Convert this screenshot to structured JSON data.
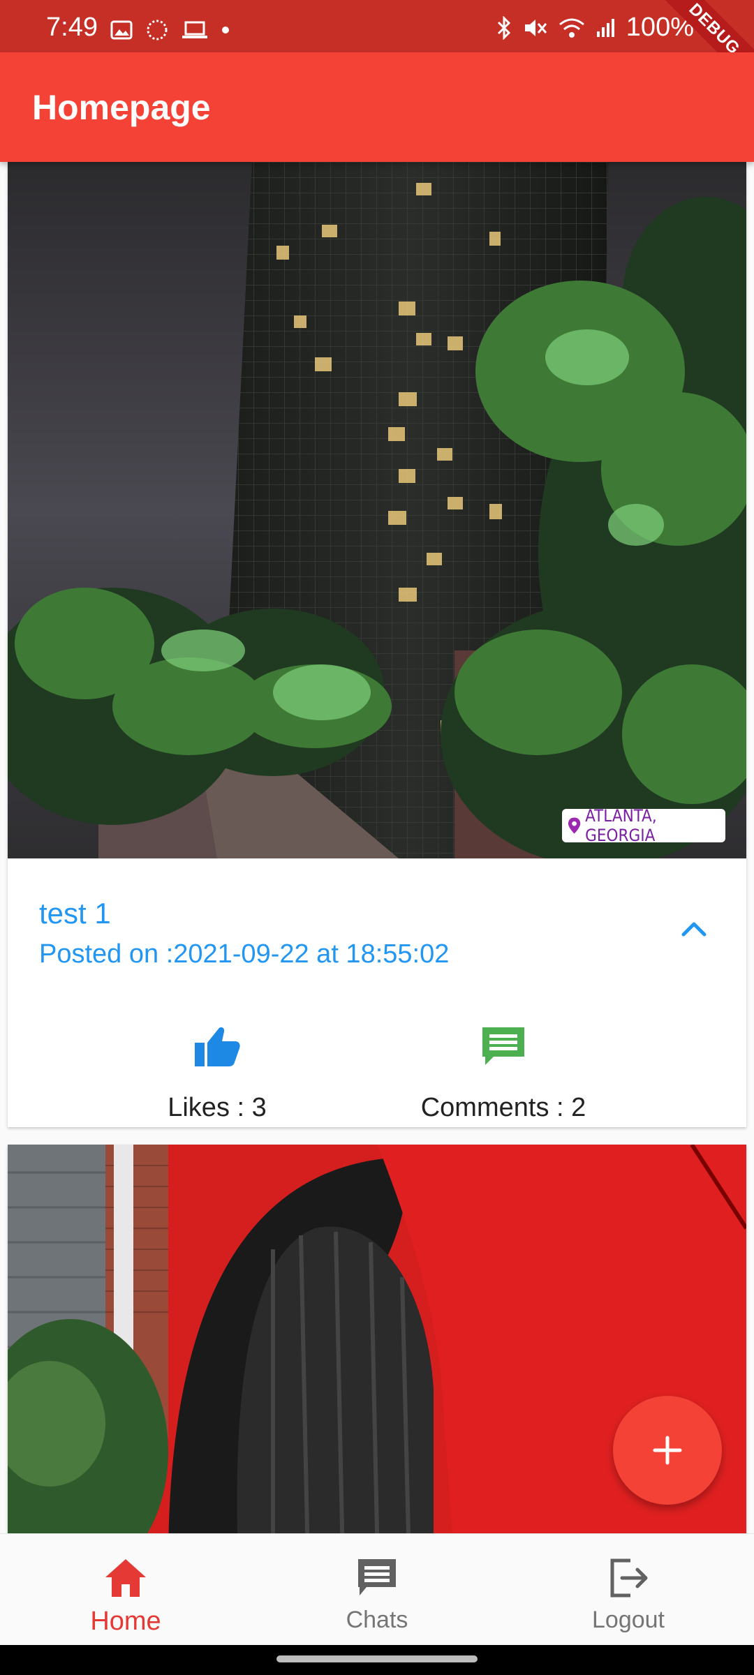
{
  "status_bar": {
    "time": "7:49",
    "battery": "100%",
    "debug_banner": "DEBUG"
  },
  "app_bar": {
    "title": "Homepage"
  },
  "posts": [
    {
      "location_tag": "ATLANTA, GEORGIA",
      "title": "test 1",
      "date": "Posted on :2021-09-22 at 18:55:02",
      "likes_label": "Likes : 3",
      "comments_label": "Comments : 2"
    }
  ],
  "fab": {
    "icon": "add-icon"
  },
  "bottom_nav": {
    "items": [
      {
        "label": "Home",
        "icon": "home-icon",
        "active": true
      },
      {
        "label": "Chats",
        "icon": "chat-icon",
        "active": false
      },
      {
        "label": "Logout",
        "icon": "logout-icon",
        "active": false
      }
    ]
  },
  "colors": {
    "primary": "#f44336",
    "status_bar": "#c62f26",
    "link_blue": "#2196f3",
    "like_blue": "#1e88e5",
    "comment_green": "#4caf50"
  }
}
